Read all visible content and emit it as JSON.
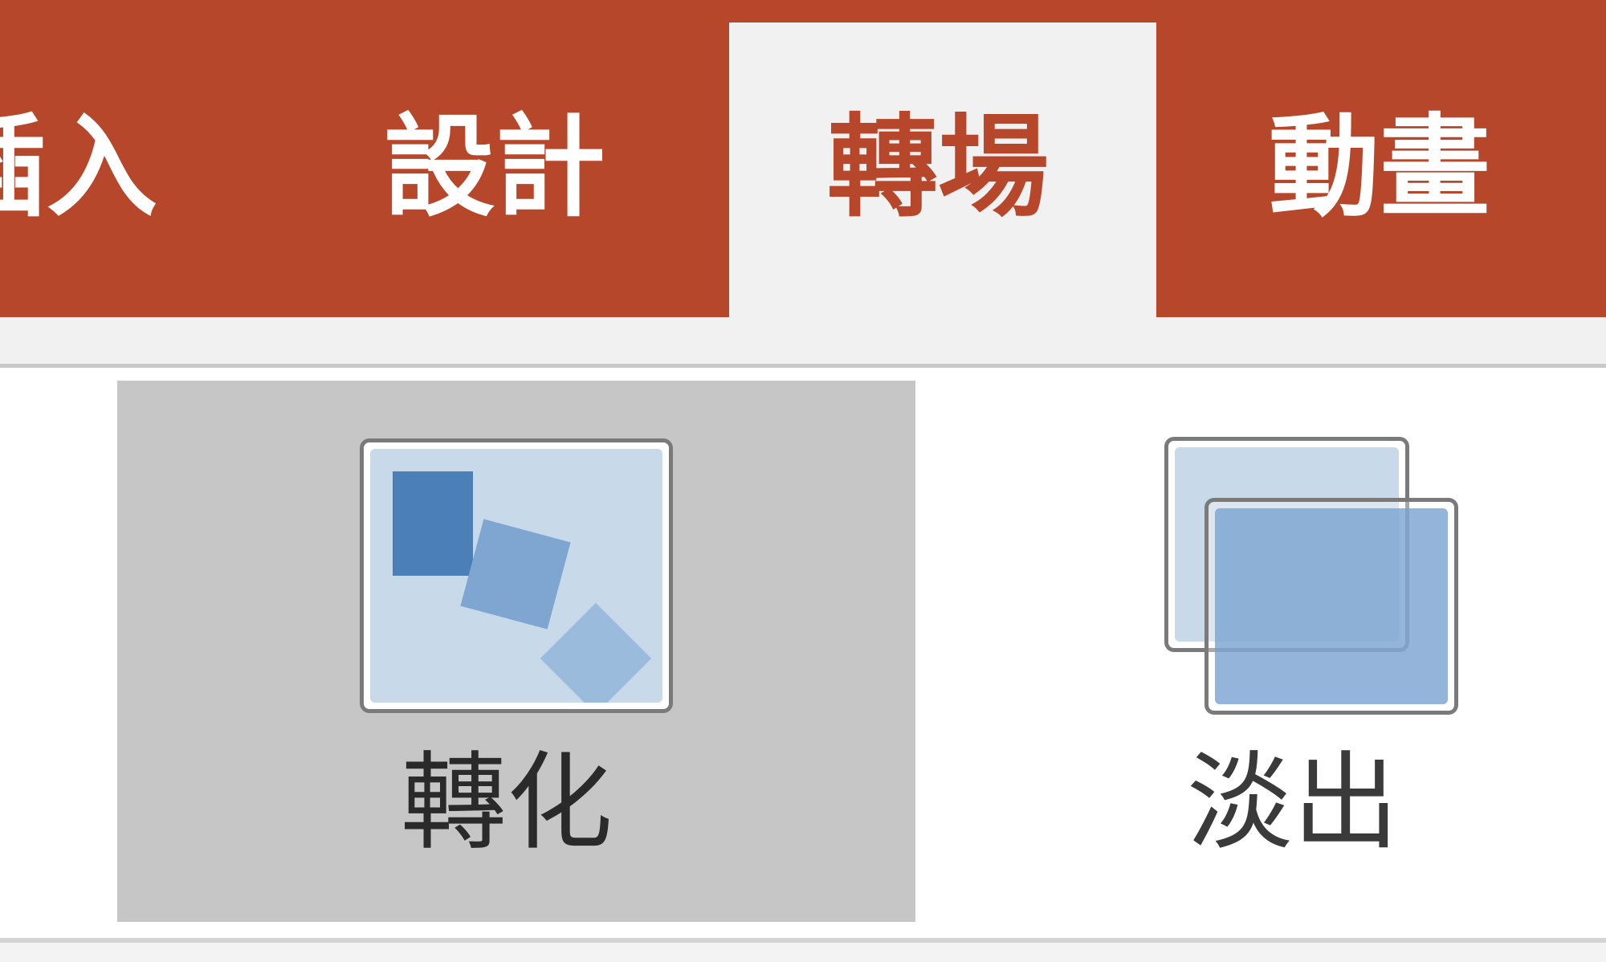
{
  "ribbon": {
    "tabs": [
      {
        "id": "insert",
        "label": "插入",
        "visible_label": "揷入"
      },
      {
        "id": "design",
        "label": "設計"
      },
      {
        "id": "transitions",
        "label": "轉場",
        "active": true
      },
      {
        "id": "animations",
        "label": "動畫"
      }
    ],
    "colors": {
      "tab_bar": "#b7472a",
      "active_tab_bg": "#f1f1f1",
      "active_tab_text": "#b7472a",
      "selected_item_bg": "#c6c6c6",
      "thumb_accent": "#4a7fb8"
    }
  },
  "gallery": {
    "items": [
      {
        "id": "morph",
        "label": "轉化",
        "icon": "morph-transition-icon",
        "selected": true
      },
      {
        "id": "fade",
        "label": "淡出",
        "icon": "fade-transition-icon",
        "selected": false
      }
    ]
  }
}
